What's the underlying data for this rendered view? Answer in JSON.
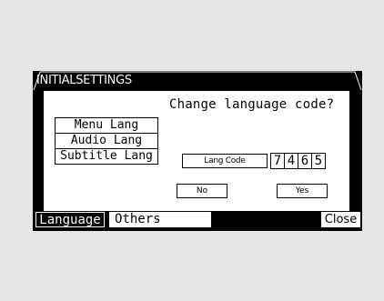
{
  "header": {
    "title": "INITIALSETTINGS"
  },
  "dialog": {
    "prompt": "Change language code?",
    "menu_items": [
      {
        "label": "Menu Lang"
      },
      {
        "label": "Audio Lang"
      },
      {
        "label": "Subtitle Lang"
      }
    ],
    "code_label": "Lang Code",
    "code_digits": [
      "7",
      "4",
      "6",
      "5"
    ],
    "no_label": "No",
    "yes_label": "Yes"
  },
  "tabs": {
    "language": "Language",
    "others": "Others",
    "close": "Close"
  },
  "colors": {
    "background": "#e6e6e6",
    "screen": "#000000",
    "panel": "#ffffff"
  }
}
